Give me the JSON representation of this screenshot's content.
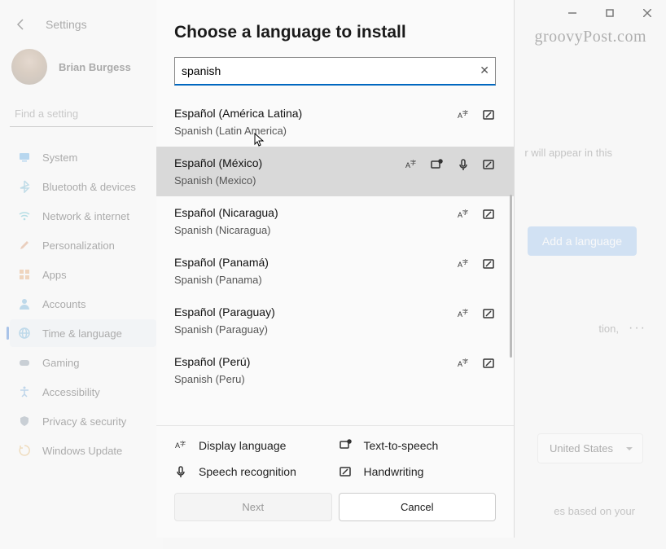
{
  "titlebar": {
    "minimize": "—",
    "maximize": "▢",
    "close": "✕"
  },
  "watermark": "groovyPost.com",
  "header": {
    "settings": "Settings"
  },
  "user": {
    "name": "Brian Burgess"
  },
  "search_settings_placeholder": "Find a setting",
  "nav": [
    {
      "icon": "monitor",
      "label": "System",
      "color": "#4aa0e6"
    },
    {
      "icon": "bluetooth",
      "label": "Bluetooth & devices",
      "color": "#5fb0d0"
    },
    {
      "icon": "wifi",
      "label": "Network & internet",
      "color": "#44b4c8"
    },
    {
      "icon": "brush",
      "label": "Personalization",
      "color": "#d88a5a"
    },
    {
      "icon": "grid",
      "label": "Apps",
      "color": "#e69a5a"
    },
    {
      "icon": "person",
      "label": "Accounts",
      "color": "#5aa8d6"
    },
    {
      "icon": "globe",
      "label": "Time & language",
      "color": "#5aa8d6",
      "active": true
    },
    {
      "icon": "gamepad",
      "label": "Gaming",
      "color": "#7a8a9a"
    },
    {
      "icon": "access",
      "label": "Accessibility",
      "color": "#5a9ad6"
    },
    {
      "icon": "shield",
      "label": "Privacy & security",
      "color": "#7a8a9a"
    },
    {
      "icon": "update",
      "label": "Windows Update",
      "color": "#e6b05a"
    }
  ],
  "right": {
    "add_language": "Add a language",
    "hint1": "r will appear in this",
    "hint2": "tion,",
    "region_value": "United States",
    "hint4": "es based on your"
  },
  "dialog": {
    "title": "Choose a language to install",
    "search_value": "spanish",
    "results": [
      {
        "native": "Español (América Latina)",
        "english": "Spanish (Latin America)",
        "features": [
          "display",
          "handwriting"
        ]
      },
      {
        "native": "Español (México)",
        "english": "Spanish (Mexico)",
        "features": [
          "display",
          "tts",
          "speech",
          "handwriting"
        ],
        "hover": true
      },
      {
        "native": "Español (Nicaragua)",
        "english": "Spanish (Nicaragua)",
        "features": [
          "display",
          "handwriting"
        ]
      },
      {
        "native": "Español (Panamá)",
        "english": "Spanish (Panama)",
        "features": [
          "display",
          "handwriting"
        ]
      },
      {
        "native": "Español (Paraguay)",
        "english": "Spanish (Paraguay)",
        "features": [
          "display",
          "handwriting"
        ]
      },
      {
        "native": "Español (Perú)",
        "english": "Spanish (Peru)",
        "features": [
          "display",
          "handwriting"
        ]
      }
    ],
    "legend": {
      "display": "Display language",
      "tts": "Text-to-speech",
      "speech": "Speech recognition",
      "handwriting": "Handwriting"
    },
    "next": "Next",
    "cancel": "Cancel"
  }
}
